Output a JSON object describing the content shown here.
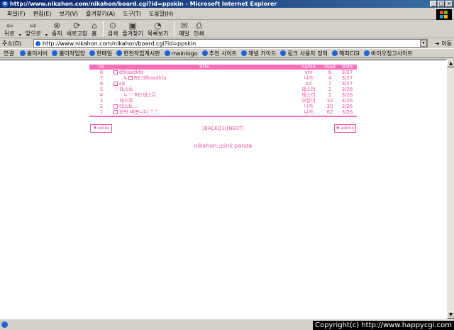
{
  "window": {
    "title": "http://www.nikahon.com/nikahon/board.cgi?id=ppskin - Microsoft Internet Explorer",
    "min": "_",
    "max": "□",
    "close": "×"
  },
  "menu": [
    "파일(F)",
    "편집(E)",
    "보기(V)",
    "즐겨찾기(A)",
    "도구(T)",
    "도움말(H)"
  ],
  "toolbar": {
    "back": "뒤로",
    "forward": "앞으로",
    "stop": "중지",
    "refresh": "새로고침",
    "home": "홈",
    "search": "검색",
    "favorites": "즐겨찾기",
    "history": "목록보기",
    "mail": "메일",
    "print": "인쇄"
  },
  "address": {
    "label": "주소(D)",
    "url": "http://www.nikahon.com/nikahon/board.cgi?id=ppskin",
    "go": "이동"
  },
  "links": {
    "label": "연결",
    "items": [
      "홈이서버",
      "홈이작업장",
      "한메일",
      "한천작업계시판",
      "mainlogo",
      "추천 사이트",
      "채널 가이드",
      "링크 사용자 정의",
      "해피CGI",
      "바이오청고사이트"
    ]
  },
  "board": {
    "headers": {
      "no": "no",
      "title": "title",
      "name": "name",
      "read": "read",
      "date": "date"
    },
    "rows": [
      {
        "no": "8",
        "title": "dfkasdkfa",
        "name": "yfx",
        "read": "6",
        "date": "3/27",
        "reply": false,
        "icon": "doc"
      },
      {
        "no": "7",
        "title": "RE:dfkasdkfa",
        "name": "니카",
        "read": "4",
        "date": "3/27",
        "reply": true,
        "icon": "doc"
      },
      {
        "no": "6",
        "title": "sd",
        "name": "sd",
        "read": "7",
        "date": "3/27",
        "reply": false,
        "icon": "doc"
      },
      {
        "no": "5",
        "title": "테스트",
        "name": "테스터",
        "read": "1",
        "date": "3/26",
        "reply": false,
        "icon": "heart"
      },
      {
        "no": "4",
        "title": "RE:테스트",
        "name": "테스터",
        "read": "1",
        "date": "3/26",
        "reply": true,
        "icon": "heart"
      },
      {
        "no": "3",
        "title": "테스투",
        "name": "부킹이",
        "read": "32",
        "date": "3/26",
        "reply": false,
        "icon": "heart"
      },
      {
        "no": "2",
        "title": "테스트...",
        "name": "니카",
        "read": "30",
        "date": "3/26",
        "reply": false,
        "icon": "doc"
      },
      {
        "no": "1",
        "title": "한번 써봅니다 ^^",
        "name": "니카",
        "read": "62",
        "date": "3/26",
        "reply": false,
        "icon": "doc"
      }
    ],
    "write": "write",
    "admin": "admin",
    "pager": "[BACK][1][NEXT]",
    "footer": "nikahon::pink panda"
  },
  "status": {
    "copyright": "Copyright(c) http://www.happycgi.com"
  },
  "colors": {
    "accent": "#f04fa0",
    "header": "#f96cb8"
  }
}
